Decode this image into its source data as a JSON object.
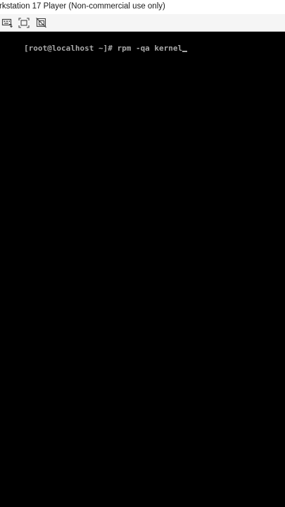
{
  "window": {
    "title": "rkstation 17 Player (Non-commercial use only)"
  },
  "toolbar": {
    "buttons": [
      {
        "icon": "send-ctrl-alt-del-icon"
      },
      {
        "icon": "fit-guest-icon"
      },
      {
        "icon": "unity-off-icon"
      }
    ]
  },
  "console": {
    "line": "[root@localhost ~]# rpm -qa kernel",
    "text_color": "#a8a8a8",
    "background": "#000000"
  }
}
